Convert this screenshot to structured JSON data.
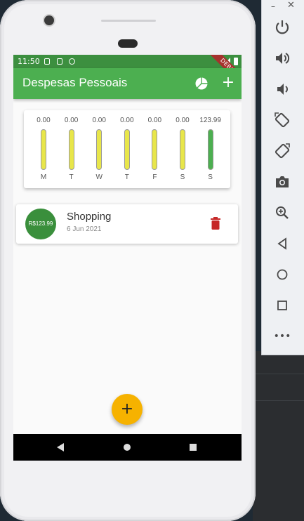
{
  "app": {
    "title": "Despesas Pessoais",
    "debug_banner": "DEBUG"
  },
  "status_bar": {
    "time": "11:50"
  },
  "chart_data": {
    "type": "bar",
    "categories": [
      "M",
      "T",
      "W",
      "T",
      "F",
      "S",
      "S"
    ],
    "values": [
      0.0,
      0.0,
      0.0,
      0.0,
      0.0,
      0.0,
      123.99
    ],
    "labels": [
      "0.00",
      "0.00",
      "0.00",
      "0.00",
      "0.00",
      "0.00",
      "123.99"
    ],
    "ylim": [
      0,
      123.99
    ],
    "colors": {
      "fill": "#4caf50",
      "track": "#e8e64a"
    }
  },
  "transactions": [
    {
      "amount": "R$123.99",
      "title": "Shopping",
      "date": "6 Jun 2021"
    }
  ],
  "colors": {
    "primary": "#4caf50",
    "accent": "#f6b200",
    "avatar": "#3a8f3c",
    "delete": "#c62828"
  },
  "icons": {
    "appbar_chart": "pie-chart-icon",
    "appbar_add": "plus-icon",
    "delete": "trash-icon",
    "fab": "plus-icon"
  },
  "emulator_toolbar": {
    "minimize": "–",
    "close": "✕",
    "more": "•••",
    "buttons": [
      "power-icon",
      "volume-up-icon",
      "volume-down-icon",
      "rotate-left-icon",
      "rotate-right-icon",
      "camera-icon",
      "zoom-icon",
      "back-icon",
      "home-icon",
      "overview-icon",
      "more-icon"
    ]
  }
}
